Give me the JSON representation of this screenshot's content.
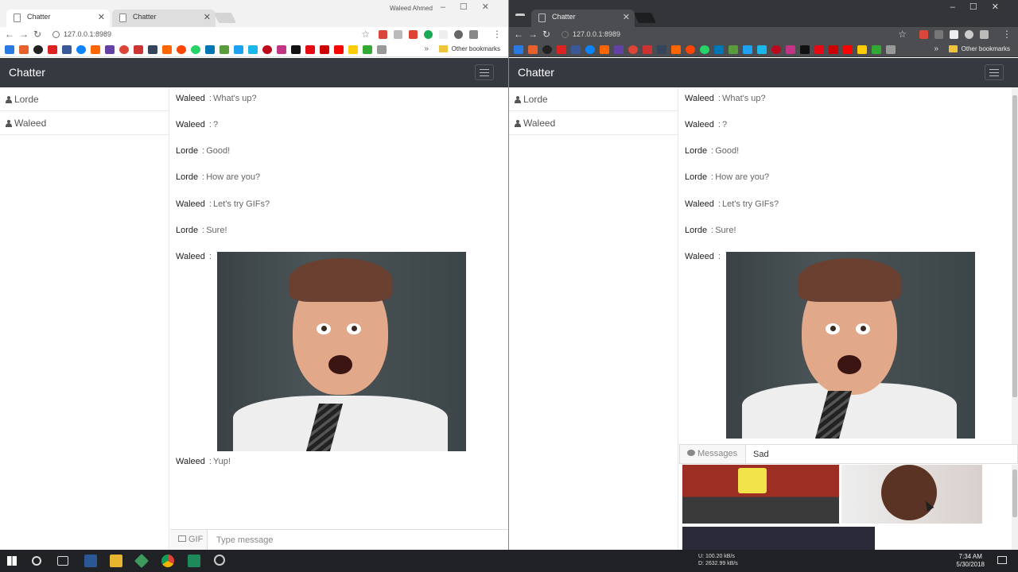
{
  "browser": {
    "left": {
      "tabs": [
        {
          "title": "Chatter"
        },
        {
          "title": "Chatter"
        }
      ],
      "url": "127.0.0.1:8989",
      "profile_name": "Waleed Ahmed",
      "other_bookmarks": "Other bookmarks"
    },
    "right": {
      "tabs": [
        {
          "title": "Chatter"
        }
      ],
      "url": "127.0.0.1:8989",
      "other_bookmarks": "Other bookmarks"
    }
  },
  "app": {
    "brand": "Chatter",
    "users": [
      "Lorde",
      "Waleed"
    ],
    "messages": [
      {
        "sender": "Waleed",
        "sep": ":",
        "text": "What's up?"
      },
      {
        "sender": "Waleed",
        "sep": ":",
        "text": "?"
      },
      {
        "sender": "Lorde",
        "sep": ":",
        "text": "Good!"
      },
      {
        "sender": "Lorde",
        "sep": ":",
        "text": "How are you?"
      },
      {
        "sender": "Waleed",
        "sep": ":",
        "text": "Let's try GIFs?"
      },
      {
        "sender": "Lorde",
        "sep": ":",
        "text": "Sure!"
      },
      {
        "sender": "Waleed",
        "sep": ":",
        "text": ""
      },
      {
        "sender": "Waleed",
        "sep": ":",
        "text": "Yup!"
      }
    ],
    "composer": {
      "gif_label": "GIF",
      "placeholder": "Type message"
    },
    "gif_search": {
      "messages_label": "Messages",
      "query": "Sad"
    }
  },
  "taskbar": {
    "net_up": "U:     100.20 kB/s",
    "net_down": "D:   2632.99 kB/s",
    "time": "7:34 AM",
    "date": "5/30/2018"
  }
}
